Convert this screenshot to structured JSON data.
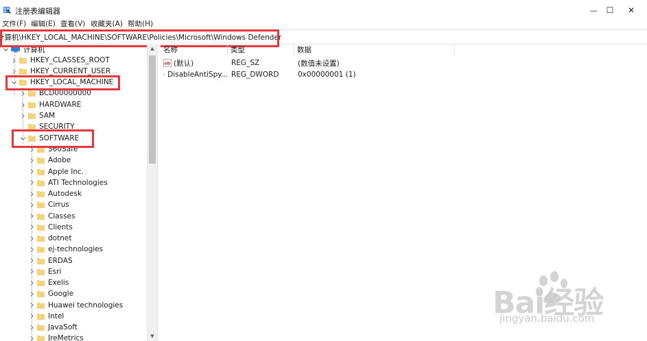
{
  "window": {
    "title": "注册表编辑器",
    "minimize_glyph": "—",
    "maximize_glyph": "☐",
    "close_glyph": "✕"
  },
  "menu": [
    "文件(F)",
    "编辑(E)",
    "查看(V)",
    "收藏夹(A)",
    "帮助(H)"
  ],
  "address": "计算机\\HKEY_LOCAL_MACHINE\\SOFTWARE\\Policies\\Microsoft\\Windows Defender",
  "tree": {
    "root": "计算机",
    "hives": [
      "HKEY_CLASSES_ROOT",
      "HKEY_CURRENT_USER",
      "HKEY_LOCAL_MACHINE"
    ],
    "hklm_children": [
      "BCD00000000",
      "HARDWARE",
      "SAM",
      "SECURITY",
      "SOFTWARE"
    ],
    "software_children": [
      "360Safe",
      "Adobe",
      "Apple Inc.",
      "ATI Technologies",
      "Autodesk",
      "Cirrus",
      "Classes",
      "Clients",
      "dotnet",
      "ej-technologies",
      "ERDAS",
      "Esri",
      "Exelis",
      "Google",
      "Huawei technologies",
      "Intel",
      "JavaSoft",
      "JreMetrics"
    ]
  },
  "columns": {
    "name": "名称",
    "type": "类型",
    "data": "数据"
  },
  "values": [
    {
      "name": "(默认)",
      "type": "REG_SZ",
      "data": "(数值未设置)",
      "icon": "string-value-icon"
    },
    {
      "name": "DisableAntiSpy...",
      "type": "REG_DWORD",
      "data": "0x00000001 (1)",
      "icon": "dword-value-icon"
    }
  ],
  "watermark": {
    "brand": "Bai经验",
    "url": "jingyan.baidu.com"
  },
  "colors": {
    "highlight": "#e8363d",
    "folder": "#f4d37b",
    "computer": "#2b82d9"
  }
}
